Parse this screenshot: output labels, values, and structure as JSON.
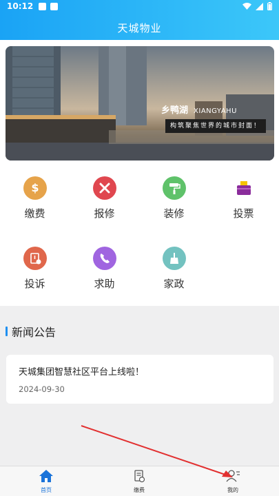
{
  "status": {
    "time": "10:12"
  },
  "header": {
    "title": "天城物业"
  },
  "banner": {
    "brand_cn": "乡鸭湖",
    "brand_en": "XIANGYAHU",
    "slogan": "构筑聚焦世界的城市封面！"
  },
  "grid": {
    "items": [
      {
        "label": "缴费",
        "icon": "payment-icon",
        "color": "#e6a34a"
      },
      {
        "label": "报修",
        "icon": "repair-tools-icon",
        "color": "#e0474f"
      },
      {
        "label": "装修",
        "icon": "paint-roller-icon",
        "color": "#5fc26a"
      },
      {
        "label": "投票",
        "icon": "ballot-box-icon",
        "color": "#8a2c9b"
      },
      {
        "label": "投诉",
        "icon": "complaint-icon",
        "color": "#e0674b"
      },
      {
        "label": "求助",
        "icon": "phone-help-icon",
        "color": "#a065e0"
      },
      {
        "label": "家政",
        "icon": "broom-icon",
        "color": "#73c2c0"
      }
    ]
  },
  "news": {
    "section_title": "新闻公告",
    "items": [
      {
        "headline": "天城集团智慧社区平台上线啦！",
        "date": "2024-09-30"
      }
    ]
  },
  "tabbar": {
    "items": [
      {
        "label": "首页",
        "icon": "home-icon",
        "active": true
      },
      {
        "label": "缴费",
        "icon": "bill-icon",
        "active": false
      },
      {
        "label": "我的",
        "icon": "user-icon",
        "active": false
      }
    ]
  },
  "colors": {
    "header_start": "#1aa3f5",
    "header_end": "#3cc7f9",
    "active_tab": "#1a73d9",
    "annotation_arrow": "#e23030"
  }
}
